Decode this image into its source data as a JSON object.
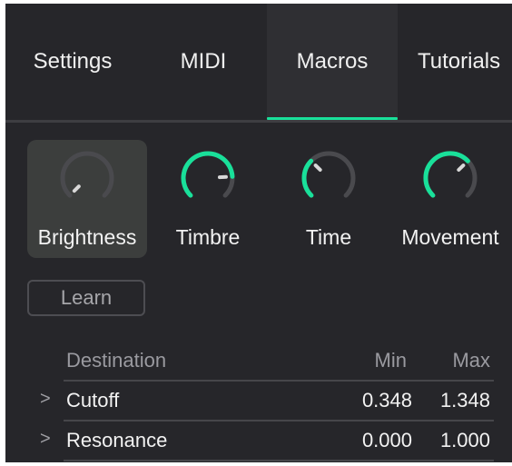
{
  "tabs": [
    {
      "label": "Settings",
      "active": false
    },
    {
      "label": "MIDI",
      "active": false
    },
    {
      "label": "Macros",
      "active": true
    },
    {
      "label": "Tutorials",
      "active": false
    }
  ],
  "colors": {
    "accent": "#19e09a",
    "panel": "#26262a",
    "selected_knob_bg": "#3c3e3d",
    "knob_track": "#4a4a4e",
    "knob_pointer": "#d8d8d8"
  },
  "macros": [
    {
      "label": "Brightness",
      "value": 0.0,
      "selected": true,
      "icon": "knob-icon"
    },
    {
      "label": "Timbre",
      "value": 0.82,
      "selected": false,
      "icon": "knob-icon"
    },
    {
      "label": "Time",
      "value": 0.33,
      "selected": false,
      "icon": "knob-icon"
    },
    {
      "label": "Movement",
      "value": 0.67,
      "selected": false,
      "icon": "knob-icon"
    }
  ],
  "learn_label": "Learn",
  "table": {
    "headers": {
      "destination": "Destination",
      "min": "Min",
      "max": "Max"
    },
    "rows": [
      {
        "destination": "Cutoff",
        "min": "0.348",
        "max": "1.348",
        "icon": "chevron-right-icon"
      },
      {
        "destination": "Resonance",
        "min": "0.000",
        "max": "1.000",
        "icon": "chevron-right-icon"
      }
    ]
  }
}
